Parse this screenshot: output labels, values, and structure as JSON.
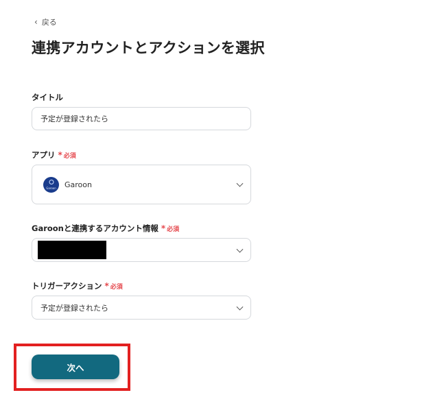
{
  "back": {
    "label": "戻る"
  },
  "page": {
    "title": "連携アカウントとアクションを選択"
  },
  "required_label": "必須",
  "fields": {
    "title": {
      "label": "タイトル",
      "value": "予定が登録されたら"
    },
    "app": {
      "label": "アプリ",
      "value": "Garoon",
      "logo_text": "Garoon"
    },
    "account": {
      "label": "Garoonと連携するアカウント情報"
    },
    "trigger": {
      "label": "トリガーアクション",
      "value": "予定が登録されたら"
    }
  },
  "actions": {
    "next_label": "次へ"
  },
  "colors": {
    "primary_button": "#12697f",
    "required": "#e5484d",
    "highlight": "#e22020"
  }
}
